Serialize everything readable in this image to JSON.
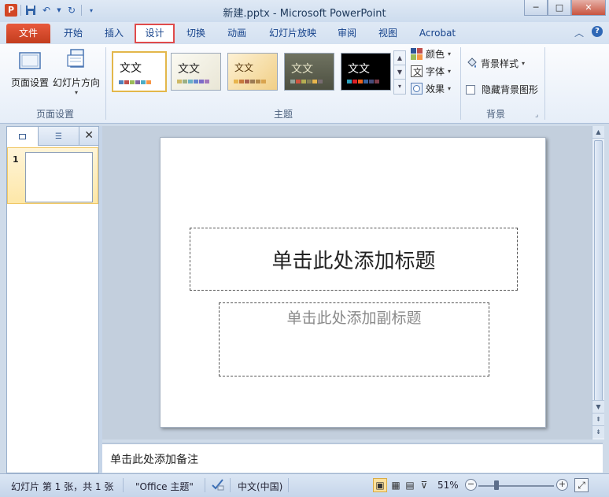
{
  "window": {
    "title": "新建.pptx - Microsoft PowerPoint",
    "app_icon_letter": "P",
    "minimize": "─",
    "maximize": "□",
    "close": "✕"
  },
  "ribbon_tabs": [
    {
      "label": "文件"
    },
    {
      "label": "开始"
    },
    {
      "label": "插入"
    },
    {
      "label": "设计"
    },
    {
      "label": "切换"
    },
    {
      "label": "动画"
    },
    {
      "label": "幻灯片放映"
    },
    {
      "label": "审阅"
    },
    {
      "label": "视图"
    },
    {
      "label": "Acrobat"
    }
  ],
  "active_tab": "设计",
  "page_setup_group": {
    "page_setup": "页面设置",
    "slide_orientation": "幻灯片方向",
    "label": "页面设置"
  },
  "themes_group": {
    "label": "主题",
    "theme_sample_text": "文文",
    "colors": "颜色",
    "fonts": "字体",
    "effects": "效果"
  },
  "background_group": {
    "label": "背景",
    "background_styles": "背景样式",
    "hide_background_graphics": "隐藏背景图形"
  },
  "slide_panel": {
    "slide_number": "1"
  },
  "slide": {
    "title_placeholder": "单击此处添加标题",
    "subtitle_placeholder": "单击此处添加副标题"
  },
  "notes": {
    "placeholder": "单击此处添加备注"
  },
  "status_bar": {
    "slide_info": "幻灯片 第 1 张，共 1 张",
    "theme_name": "\"Office 主题\"",
    "language": "中文(中国)",
    "zoom": "51%"
  },
  "colors": {
    "file_tab": "#d24726",
    "active_tab_highlight": "#e04b4b",
    "selected_theme_border": "#e3b74a"
  }
}
